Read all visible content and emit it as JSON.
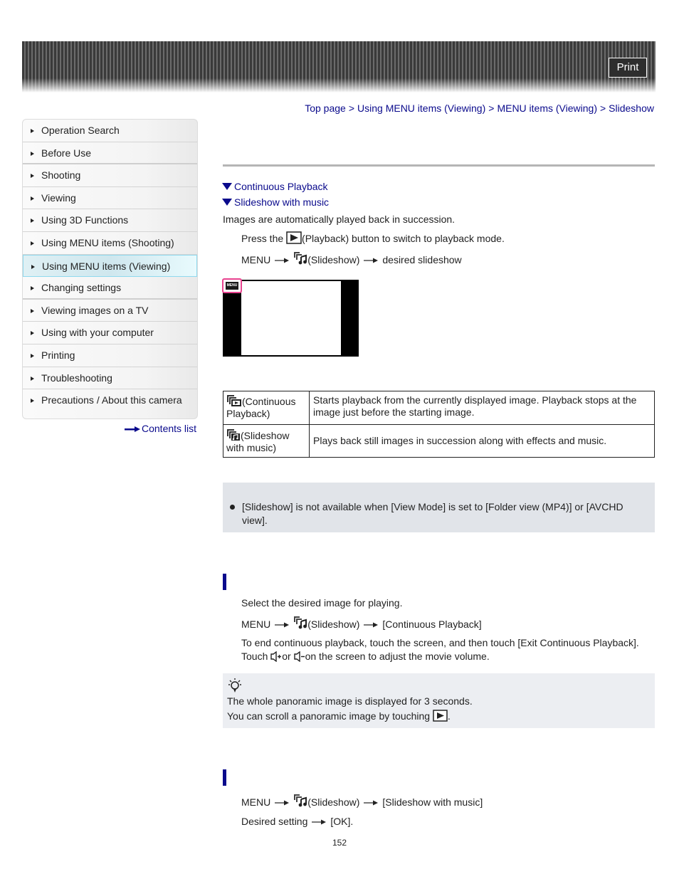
{
  "header": {
    "print_label": "Print"
  },
  "breadcrumb": {
    "items": [
      "Top page",
      "Using MENU items (Viewing)",
      "MENU items (Viewing)",
      "Slideshow"
    ],
    "separator": ">"
  },
  "sidebar": {
    "items": [
      {
        "label": "Operation Search",
        "active": false
      },
      {
        "label": "Before Use",
        "active": false
      },
      {
        "label": "Shooting",
        "active": false
      },
      {
        "label": "Viewing",
        "active": false
      },
      {
        "label": "Using 3D Functions",
        "active": false
      },
      {
        "label": "Using MENU items (Shooting)",
        "active": false
      },
      {
        "label": "Using MENU items (Viewing)",
        "active": true
      },
      {
        "label": "Changing settings",
        "active": false
      },
      {
        "label": "Viewing images on a TV",
        "active": false
      },
      {
        "label": "Using with your computer",
        "active": false
      },
      {
        "label": "Printing",
        "active": false
      },
      {
        "label": "Troubleshooting",
        "active": false
      },
      {
        "label": "Precautions / About this camera",
        "active": false
      }
    ],
    "contents_link": "Contents list"
  },
  "main": {
    "anchors": [
      "Continuous Playback",
      "Slideshow with music"
    ],
    "intro": "Images are automatically played back in succession.",
    "step1": {
      "before": "Press the",
      "after": "(Playback) button to switch to playback mode."
    },
    "step2": {
      "menu": "MENU",
      "item": "(Slideshow)",
      "target": "desired slideshow"
    },
    "screen_menu_label": "MENU",
    "table": [
      {
        "icon": "continuous-playback-icon",
        "name": "(Continuous Playback)",
        "description": "Starts playback from the currently displayed image. Playback stops at the image just before the starting image."
      },
      {
        "icon": "slideshow-with-music-icon",
        "name": "(Slideshow with music)",
        "description": "Plays back still images in succession along with effects and music."
      }
    ],
    "note": "[Slideshow] is not available when [View Mode] is set to [Folder view (MP4)] or [AVCHD view].",
    "continuous": {
      "step1": "Select the desired image for playing.",
      "step2": {
        "menu": "MENU",
        "item": "(Slideshow)",
        "target": "[Continuous Playback]"
      },
      "line1": "To end continuous playback, touch the screen, and then touch [Exit Continuous Playback].",
      "line2": {
        "a": "Touch",
        "b": "or",
        "c": "on the screen to adjust the movie volume."
      }
    },
    "hint": {
      "line1": "The whole panoramic image is displayed for 3 seconds.",
      "line2": "You can scroll a panoramic image by touching",
      "line2_end": "."
    },
    "music": {
      "step1": {
        "menu": "MENU",
        "item": "(Slideshow)",
        "target": "[Slideshow with music]"
      },
      "step2": {
        "a": "Desired setting",
        "b": "[OK]."
      }
    }
  },
  "page_number": "152",
  "colors": {
    "link": "#0a0a8c",
    "active_nav": "#cfe7ee",
    "note_bg": "#e1e4e9",
    "highlight": "#e8438f"
  }
}
